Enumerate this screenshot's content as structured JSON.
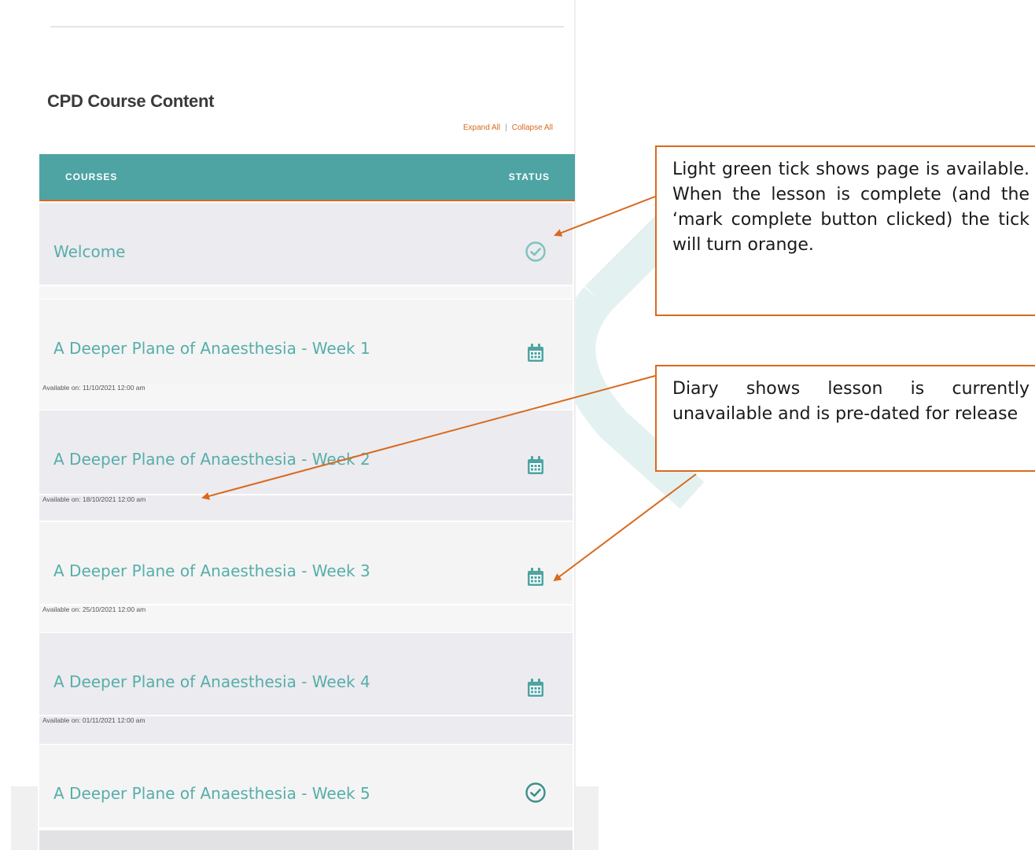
{
  "section": {
    "title": "CPD Course Content",
    "expand_all": "Expand All",
    "separator": "|",
    "collapse_all": "Collapse All"
  },
  "table": {
    "header": {
      "courses": "COURSES",
      "status": "STATUS"
    },
    "rows": [
      {
        "title": "Welcome",
        "status_icon": "check-circle-icon",
        "available": ""
      },
      {
        "title": "A Deeper Plane of Anaesthesia - Week 1",
        "status_icon": "calendar-icon",
        "available": "Available on: 11/10/2021 12:00 am"
      },
      {
        "title": "A Deeper Plane of Anaesthesia - Week 2",
        "status_icon": "calendar-icon",
        "available": "Available on: 18/10/2021 12:00 am"
      },
      {
        "title": "A Deeper Plane of Anaesthesia - Week 3",
        "status_icon": "calendar-icon",
        "available": "Available on: 25/10/2021 12:00 am"
      },
      {
        "title": "A Deeper Plane of Anaesthesia - Week 4",
        "status_icon": "calendar-icon",
        "available": "Available on: 01/11/2021 12:00 am"
      },
      {
        "title": "A Deeper Plane of Anaesthesia - Week 5",
        "status_icon": "check-circle-icon",
        "available": ""
      }
    ]
  },
  "callouts": {
    "tick": "Light green tick shows page is available.   When the lesson is complete (and the ‘mark complete button clicked) the tick will turn orange.",
    "diary": "Diary shows lesson is currently unavailable and is pre-dated for release"
  },
  "colors": {
    "accent": "#d9691e",
    "teal": "#4ea3a3",
    "link_teal": "#56aeaa"
  }
}
